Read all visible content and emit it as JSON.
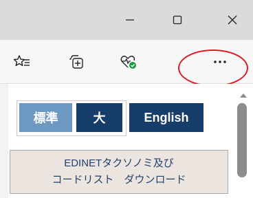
{
  "window_controls": {
    "minimize": "minimize-icon",
    "maximize": "maximize-icon",
    "close": "close-icon"
  },
  "toolbar": {
    "icons": [
      "favorites-star-icon",
      "collections-icon",
      "browser-essentials-icon",
      "more-icon"
    ],
    "more_label": "···"
  },
  "content": {
    "language_buttons": {
      "standard": "標準",
      "large": "大",
      "english": "English"
    },
    "taxonomy_link": {
      "line1": "EDINETタクソノミ及び",
      "line2": "コードリスト　ダウンロード"
    }
  },
  "colors": {
    "highlight": "#e01a24",
    "button_dark": "#173e6b",
    "button_light": "#6d98c1",
    "link_bg": "#ece5df",
    "link_text": "#22406c"
  }
}
